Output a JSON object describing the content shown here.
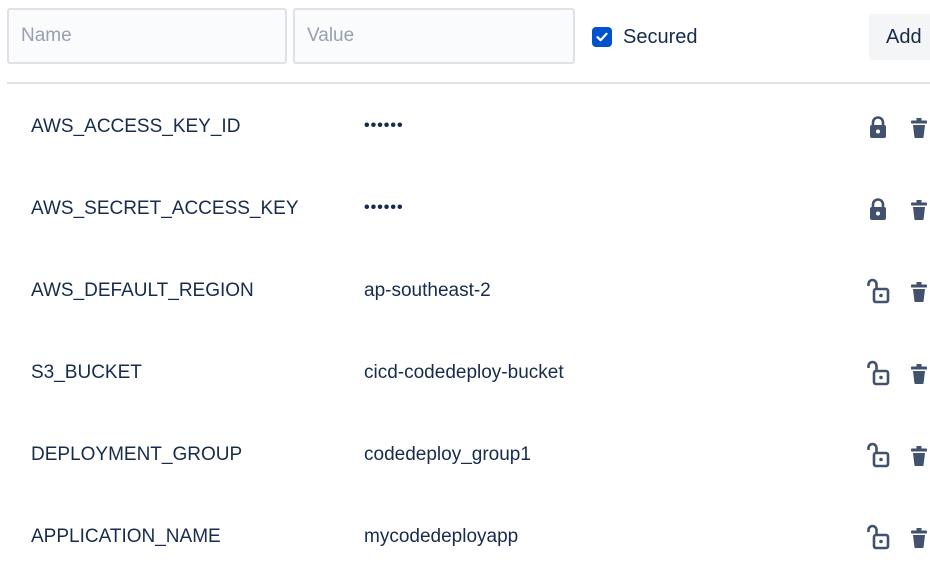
{
  "form": {
    "name_placeholder": "Name",
    "value_placeholder": "Value",
    "secured_label": "Secured",
    "secured_checked": true,
    "add_label": "Add"
  },
  "variables": [
    {
      "name": "AWS_ACCESS_KEY_ID",
      "value": "••••••",
      "secured": true,
      "icon": "lock-closed-icon"
    },
    {
      "name": "AWS_SECRET_ACCESS_KEY",
      "value": "••••••",
      "secured": true,
      "icon": "lock-closed-icon"
    },
    {
      "name": "AWS_DEFAULT_REGION",
      "value": "ap-southeast-2",
      "secured": false,
      "icon": "lock-open-icon"
    },
    {
      "name": "S3_BUCKET",
      "value": "cicd-codedeploy-bucket",
      "secured": false,
      "icon": "lock-open-icon"
    },
    {
      "name": "DEPLOYMENT_GROUP",
      "value": "codedeploy_group1",
      "secured": false,
      "icon": "lock-open-icon"
    },
    {
      "name": "APPLICATION_NAME",
      "value": "mycodedeployapp",
      "secured": false,
      "icon": "lock-open-icon"
    }
  ],
  "colors": {
    "accent": "#0052cc",
    "text": "#172b4d",
    "placeholder": "#97a0af",
    "border": "#dfe1e6",
    "icon": "#42526e",
    "button_bg": "#f4f5f7"
  }
}
